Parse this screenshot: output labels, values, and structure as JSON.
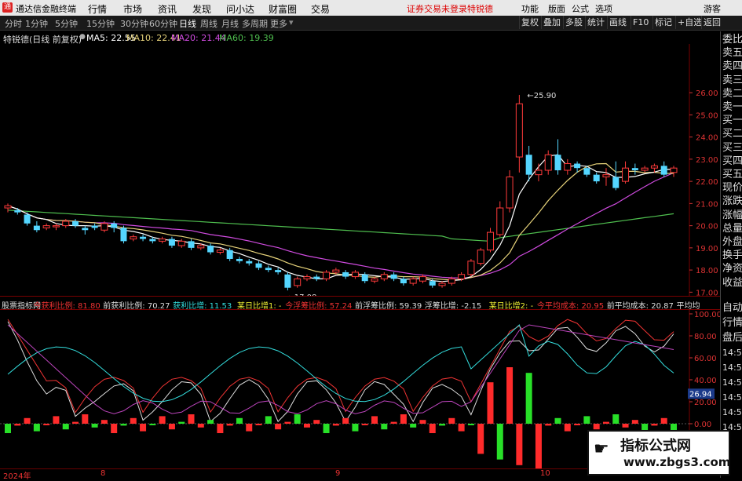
{
  "titlebar": {
    "app_name": "通达信金融终端",
    "menu": [
      "行情",
      "市场",
      "资讯",
      "发现",
      "问小达",
      "财富圈",
      "交易"
    ],
    "notice": "证券交易未登录",
    "stock_link": "特锐德",
    "right_menu": [
      "功能",
      "版面",
      "公式",
      "选项"
    ],
    "guest": "游客"
  },
  "toolbar": {
    "periods": [
      "分时",
      "1分钟",
      "5分钟",
      "15分钟",
      "30分钟",
      "60分钟",
      "日线",
      "周线",
      "月线",
      "多周期",
      "更多"
    ],
    "active_period": "日线",
    "right_buttons": [
      "复权",
      "叠加",
      "多股",
      "统计",
      "画线",
      "F10",
      "标记",
      "+自选",
      "返回"
    ]
  },
  "legend": {
    "title": "特锐德(日线 前复权)",
    "ma5": "MA5: 22.55",
    "ma10": "MA10: 22.41",
    "ma20": "MA20: 21.44",
    "ma60": "MA60: 19.39",
    "colors": {
      "ma5": "#ffffff",
      "ma10": "#e6d27a",
      "ma20": "#d04be0",
      "ma60": "#4fbf4f"
    }
  },
  "price_axis": [
    "26.00",
    "25.00",
    "24.00",
    "23.00",
    "22.00",
    "21.00",
    "20.00",
    "19.00",
    "18.00",
    "17.00"
  ],
  "annotations": {
    "high": "25.90",
    "low": "17.08"
  },
  "sidepanel": [
    "委比",
    "卖五",
    "卖四",
    "卖三",
    "卖二",
    "卖一",
    "买一",
    "买二",
    "买三",
    "买四",
    "买五",
    "现价",
    "涨跌",
    "涨幅",
    "总量",
    "外盘",
    "换手",
    "净资",
    "收益"
  ],
  "sidepanel_bottom": [
    "自动",
    "行情",
    "盘后",
    "14:50",
    "14:50",
    "14:50",
    "14:50",
    "14:50",
    "14:50"
  ],
  "indicator": {
    "name": "股票指标网",
    "items": [
      {
        "label": "今获利比例: 81.80",
        "color": "#e33"
      },
      {
        "label": "前获利比例: 70.27",
        "color": "#ddd"
      },
      {
        "label": "获利比增: 11.53",
        "color": "#3dd"
      },
      {
        "label": "某日比增1: -",
        "color": "#ee3"
      },
      {
        "label": "今浮筹比例: 57.24",
        "color": "#e33"
      },
      {
        "label": "前浮筹比例: 59.39",
        "color": "#ddd"
      },
      {
        "label": "浮筹比增: -2.15",
        "color": "#ddd"
      },
      {
        "label": "某日比增2: -",
        "color": "#ee3"
      },
      {
        "label": "今平均成本: 20.95",
        "color": "#e33"
      },
      {
        "label": "前平均成本: 20.87",
        "color": "#ddd"
      },
      {
        "label": "平均均",
        "color": "#ddd"
      }
    ],
    "axis": [
      "100.00",
      "80.00",
      "60.00",
      "40.00",
      "20.00",
      "0.00"
    ],
    "current_value": "26.94"
  },
  "dates": [
    "2024年",
    "8",
    "9",
    "10"
  ],
  "watermark": {
    "line1": "指标公式网",
    "line2": "www.zbgs3.com"
  },
  "chart_data": {
    "type": "candlestick",
    "title": "特锐德(日线 前复权)",
    "ylim": [
      16.8,
      28.2
    ],
    "candles": [
      [
        20.8,
        20.9,
        20.6,
        21.0
      ],
      [
        20.7,
        20.6,
        20.5,
        20.8
      ],
      [
        20.5,
        20.1,
        20.0,
        20.6
      ],
      [
        20.0,
        19.8,
        19.7,
        20.2
      ],
      [
        19.9,
        20.0,
        19.8,
        20.1
      ],
      [
        20.0,
        20.0,
        19.8,
        20.1
      ],
      [
        20.0,
        20.2,
        19.9,
        20.3
      ],
      [
        20.2,
        20.0,
        19.9,
        20.3
      ],
      [
        19.9,
        19.8,
        19.6,
        20.0
      ],
      [
        20.0,
        19.9,
        19.8,
        20.1
      ],
      [
        19.8,
        20.1,
        19.7,
        20.2
      ],
      [
        20.1,
        19.9,
        19.7,
        20.2
      ],
      [
        19.9,
        19.3,
        19.2,
        20.0
      ],
      [
        19.4,
        19.5,
        19.3,
        19.6
      ],
      [
        19.5,
        19.4,
        19.3,
        19.6
      ],
      [
        19.4,
        19.3,
        19.2,
        19.5
      ],
      [
        19.3,
        19.4,
        19.2,
        19.5
      ],
      [
        19.4,
        19.1,
        19.0,
        19.5
      ],
      [
        19.1,
        19.3,
        19.0,
        19.4
      ],
      [
        19.3,
        19.0,
        18.9,
        19.4
      ],
      [
        19.0,
        19.1,
        18.9,
        19.2
      ],
      [
        19.1,
        18.8,
        18.7,
        19.2
      ],
      [
        18.8,
        18.9,
        18.7,
        19.0
      ],
      [
        18.9,
        18.5,
        18.4,
        19.0
      ],
      [
        18.5,
        18.4,
        18.3,
        18.6
      ],
      [
        18.4,
        18.3,
        18.2,
        18.5
      ],
      [
        18.3,
        18.1,
        18.0,
        18.4
      ],
      [
        18.1,
        18.0,
        17.9,
        18.2
      ],
      [
        18.0,
        17.9,
        17.8,
        18.1
      ],
      [
        17.8,
        17.2,
        17.08,
        17.9
      ],
      [
        17.3,
        17.6,
        17.2,
        17.7
      ],
      [
        17.6,
        17.7,
        17.5,
        17.8
      ],
      [
        17.7,
        17.6,
        17.5,
        17.8
      ],
      [
        17.6,
        17.9,
        17.5,
        18.0
      ],
      [
        17.9,
        18.0,
        17.8,
        18.1
      ],
      [
        17.9,
        17.7,
        17.6,
        18.0
      ],
      [
        17.7,
        17.9,
        17.6,
        18.0
      ],
      [
        17.8,
        17.5,
        17.4,
        17.9
      ],
      [
        17.5,
        17.6,
        17.4,
        17.7
      ],
      [
        17.6,
        17.8,
        17.5,
        17.9
      ],
      [
        17.8,
        17.6,
        17.5,
        17.9
      ],
      [
        17.6,
        17.4,
        17.3,
        17.7
      ],
      [
        17.4,
        17.6,
        17.3,
        17.7
      ],
      [
        17.5,
        17.7,
        17.4,
        17.8
      ],
      [
        17.5,
        17.3,
        17.2,
        17.6
      ],
      [
        17.3,
        17.4,
        17.2,
        17.5
      ],
      [
        17.4,
        17.6,
        17.3,
        17.7
      ],
      [
        17.6,
        17.8,
        17.5,
        17.9
      ],
      [
        17.8,
        18.4,
        17.7,
        18.5
      ],
      [
        18.3,
        18.9,
        18.2,
        19.0
      ],
      [
        18.9,
        19.7,
        18.8,
        19.9
      ],
      [
        19.6,
        20.8,
        19.5,
        21.1
      ],
      [
        20.8,
        22.2,
        20.6,
        22.5
      ],
      [
        23.1,
        25.5,
        22.4,
        25.9
      ],
      [
        23.2,
        22.3,
        22.0,
        23.6
      ],
      [
        22.3,
        22.5,
        22.0,
        22.8
      ],
      [
        22.5,
        23.2,
        22.3,
        23.4
      ],
      [
        23.2,
        22.5,
        22.3,
        23.9
      ],
      [
        22.5,
        22.8,
        22.3,
        23.0
      ],
      [
        22.8,
        22.6,
        22.4,
        22.9
      ],
      [
        22.6,
        22.3,
        22.2,
        22.7
      ],
      [
        22.3,
        22.0,
        21.9,
        22.4
      ],
      [
        22.2,
        22.3,
        21.8,
        22.6
      ],
      [
        22.2,
        21.7,
        21.6,
        22.9
      ],
      [
        22.0,
        22.6,
        21.9,
        22.9
      ],
      [
        22.6,
        22.5,
        22.3,
        22.8
      ],
      [
        22.5,
        22.6,
        22.4,
        22.7
      ],
      [
        22.6,
        22.7,
        22.4,
        22.8
      ],
      [
        22.7,
        22.3,
        22.2,
        22.9
      ],
      [
        22.4,
        22.6,
        22.2,
        22.7
      ]
    ]
  }
}
